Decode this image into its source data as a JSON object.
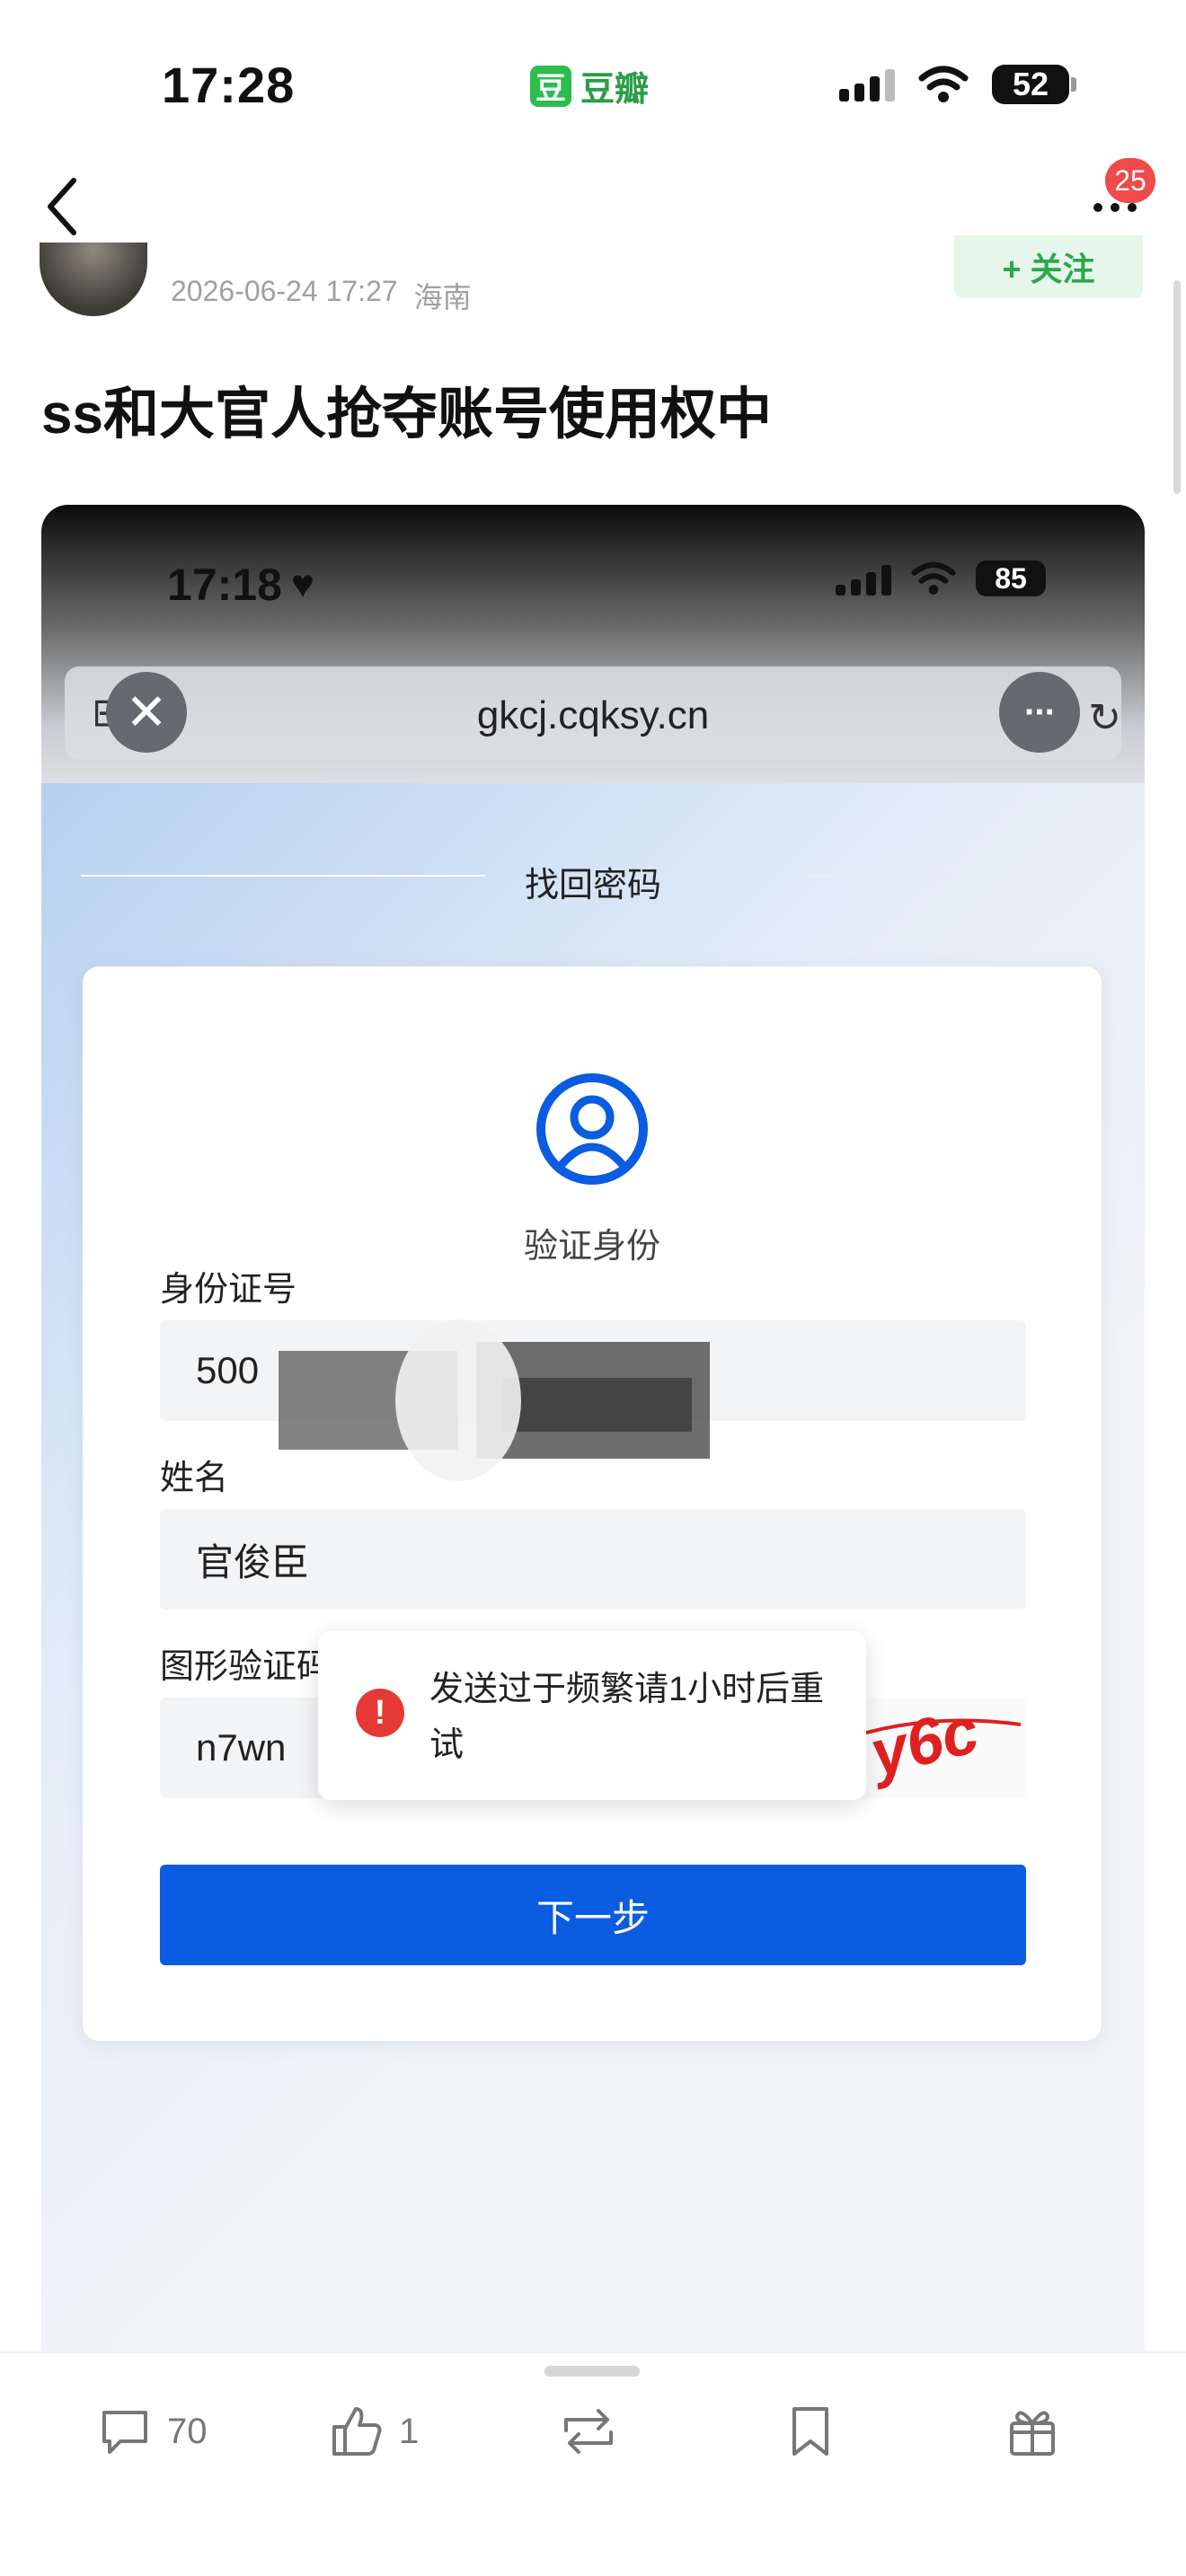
{
  "status_bar": {
    "time": "17:28",
    "app_logo_char": "豆",
    "app_name": "豆瓣",
    "battery": "52"
  },
  "nav": {
    "notification_count": "25"
  },
  "post": {
    "date": "2026-06-24 17:27",
    "location": "海南",
    "follow_label": "+ 关注",
    "title": "ss和大官人抢夺账号使用权中"
  },
  "embedded": {
    "status_time": "17:18",
    "status_battery": "85",
    "url": "gkcj.cqksy.cn",
    "section_title": "找回密码",
    "verify_label": "验证身份",
    "id_label": "身份证号",
    "id_value": "500",
    "name_label": "姓名",
    "name_value": "官俊臣",
    "captcha_label": "图形验证码",
    "captcha_value": "n7wn",
    "captcha_image_text": "w y6c",
    "next_button": "下一步",
    "toast_message": "发送过于频繁请1小时后重试"
  },
  "bottom_bar": {
    "comment_count": "70",
    "like_count": "1"
  },
  "colors": {
    "brand_green": "#2dbd4e",
    "primary_blue": "#0a5ce0",
    "badge_red": "#f04a4a",
    "error_red": "#e53935"
  }
}
